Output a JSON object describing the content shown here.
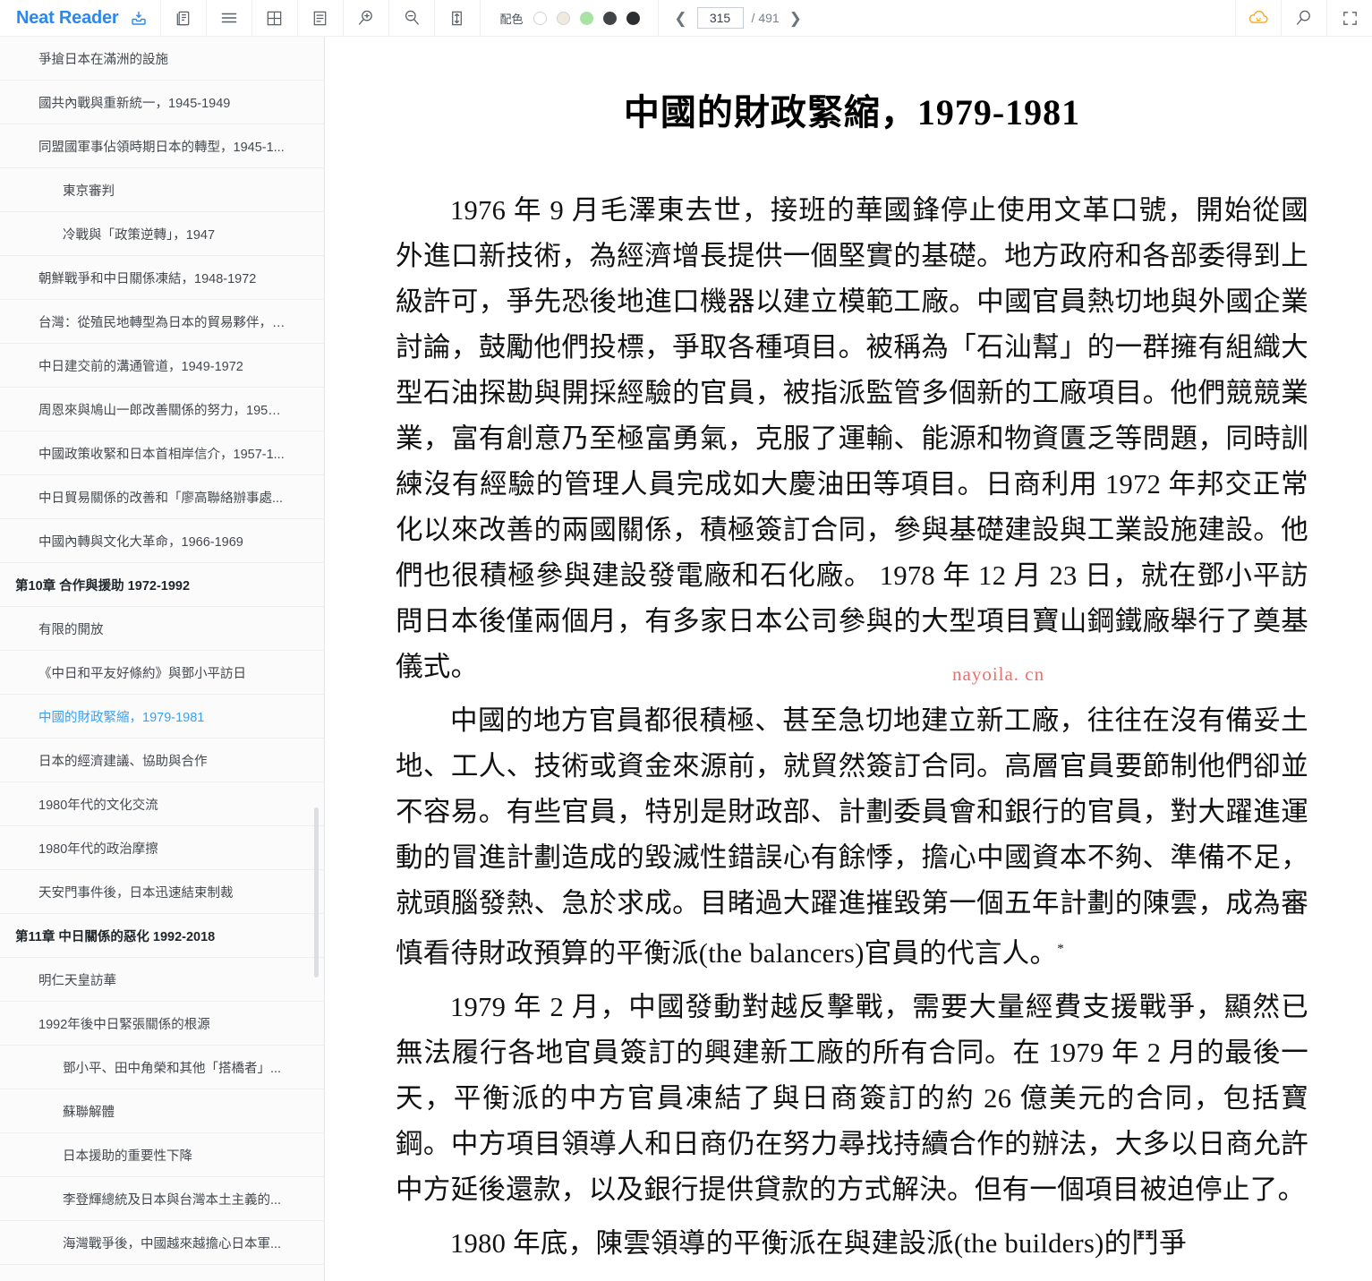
{
  "app": {
    "brand": "Neat Reader",
    "brand_color": "#2b88f0",
    "brand_icon": "download-inbox-icon"
  },
  "toolbar": {
    "buttons": [
      {
        "name": "copy-pages-icon",
        "label": "書架"
      },
      {
        "name": "list-view-icon",
        "label": "目錄"
      },
      {
        "name": "grid-view-icon",
        "label": "網格"
      },
      {
        "name": "notes-icon",
        "label": "筆記"
      },
      {
        "name": "zoom-in-icon",
        "label": "放大"
      },
      {
        "name": "zoom-out-icon",
        "label": "縮小"
      },
      {
        "name": "fit-height-icon",
        "label": "適應高度"
      }
    ],
    "theme": {
      "label": "配色",
      "swatches": [
        "#ffffff",
        "#eeeadd",
        "#a8e3a4",
        "#424548",
        "#2c2f31"
      ],
      "selected_index": 0
    },
    "pager": {
      "prev_icon": "chevron-left-icon",
      "next_icon": "chevron-right-icon",
      "current_page": "315",
      "total_label": "/ 491",
      "total_pages": "491"
    },
    "right_buttons": [
      {
        "name": "cloud-sync-icon",
        "label": "雲同步",
        "color": "#f5a623"
      },
      {
        "name": "search-icon",
        "label": "搜尋"
      },
      {
        "name": "fullscreen-icon",
        "label": "全螢幕"
      }
    ]
  },
  "sidebar": {
    "scrollbar": "visible",
    "items": [
      {
        "level": 2,
        "label": "爭搶日本在滿洲的設施",
        "active": false
      },
      {
        "level": 2,
        "label": "國共內戰與重新統一，1945-1949",
        "active": false
      },
      {
        "level": 2,
        "label": "同盟國軍事佔領時期日本的轉型，1945-1...",
        "active": false
      },
      {
        "level": 3,
        "label": "東京審判",
        "active": false
      },
      {
        "level": 3,
        "label": "冷戰與「政策逆轉」，1947",
        "active": false
      },
      {
        "level": 2,
        "label": "朝鮮戰爭和中日關係凍結，1948-1972",
        "active": false
      },
      {
        "level": 2,
        "label": "台灣：從殖民地轉型為日本的貿易夥伴，1...",
        "active": false
      },
      {
        "level": 2,
        "label": "中日建交前的溝通管道，1949-1972",
        "active": false
      },
      {
        "level": 2,
        "label": "周恩來與鳩山一郎改善關係的努力，1953-...",
        "active": false
      },
      {
        "level": 2,
        "label": "中國政策收緊和日本首相岸信介，1957-1...",
        "active": false
      },
      {
        "level": 2,
        "label": "中日貿易關係的改善和「廖高聯絡辦事處...",
        "active": false
      },
      {
        "level": 2,
        "label": "中國內轉與文化大革命，1966-1969",
        "active": false
      },
      {
        "level": 1,
        "label": "第10章 合作與援助 1972-1992",
        "active": false
      },
      {
        "level": 2,
        "label": "有限的開放",
        "active": false
      },
      {
        "level": 2,
        "label": "《中日和平友好條約》與鄧小平訪日",
        "active": false
      },
      {
        "level": 2,
        "label": "中國的財政緊縮，1979-1981",
        "active": true
      },
      {
        "level": 2,
        "label": "日本的經濟建議、協助與合作",
        "active": false
      },
      {
        "level": 2,
        "label": "1980年代的文化交流",
        "active": false
      },
      {
        "level": 2,
        "label": "1980年代的政治摩擦",
        "active": false
      },
      {
        "level": 2,
        "label": "天安門事件後，日本迅速結束制裁",
        "active": false
      },
      {
        "level": 1,
        "label": "第11章 中日關係的惡化 1992-2018",
        "active": false
      },
      {
        "level": 2,
        "label": "明仁天皇訪華",
        "active": false
      },
      {
        "level": 2,
        "label": "1992年後中日緊張關係的根源",
        "active": false
      },
      {
        "level": 3,
        "label": "鄧小平、田中角榮和其他「搭橋者」...",
        "active": false
      },
      {
        "level": 3,
        "label": "蘇聯解體",
        "active": false
      },
      {
        "level": 3,
        "label": "日本援助的重要性下降",
        "active": false
      },
      {
        "level": 3,
        "label": "李登輝總統及日本與台灣本土主義的...",
        "active": false
      },
      {
        "level": 3,
        "label": "海灣戰爭後，中國越來越擔心日本軍...",
        "active": false
      }
    ]
  },
  "document": {
    "title": "中國的財政緊縮，1979-1981",
    "watermark": "nayoila. cn",
    "watermark_color": "#e9706e",
    "paragraphs": [
      "1976 年 9 月毛澤東去世，接班的華國鋒停止使用文革口號，開始從國外進口新技術，為經濟增長提供一個堅實的基礎。地方政府和各部委得到上級許可，爭先恐後地進口機器以建立模範工廠。中國官員熱切地與外國企業討論，鼓勵他們投標，爭取各種項目。被稱為「石汕幫」的一群擁有組織大型石油探勘與開採經驗的官員，被指派監管多個新的工廠項目。他們競競業業，富有創意乃至極富勇氣，克服了運輸、能源和物資匱乏等問題，同時訓練沒有經驗的管理人員完成如大慶油田等項目。日商利用 1972 年邦交正常化以來改善的兩國關係，積極簽訂合同，參與基礎建設與工業設施建設。他們也很積極參與建設發電廠和石化廠。 1978 年 12 月 23 日，就在鄧小平訪問日本後僅兩個月，有多家日本公司參與的大型項目寶山鋼鐵廠舉行了奠基儀式。",
      "中國的地方官員都很積極、甚至急切地建立新工廠，往往在沒有備妥土地、工人、技術或資金來源前，就貿然簽訂合同。高層官員要節制他們卻並不容易。有些官員，特別是財政部、計劃委員會和銀行的官員，對大躍進運動的冒進計劃造成的毀滅性錯誤心有餘悸，擔心中國資本不夠、準備不足，就頭腦發熱、急於求成。目睹過大躍進摧毀第一個五年計劃的陳雲，成為審慎看待財政預算的平衡派(the balancers)官員的代言人。",
      "1979 年 2 月，中國發動對越反擊戰，需要大量經費支援戰爭，顯然已無法履行各地官員簽訂的興建新工廠的所有合同。在 1979 年 2 月的最後一天，平衡派的中方官員凍結了與日商簽訂的約 26 億美元的合同，包括寶鋼。中方項目領導人和日商仍在努力尋找持續合作的辦法，大多以日商允許中方延後還款，以及銀行提供貸款的方式解決。但有一個項目被迫停止了。",
      "1980 年底，陳雲領導的平衡派在與建設派(the builders)的鬥爭"
    ],
    "footnote_marker": "*"
  }
}
